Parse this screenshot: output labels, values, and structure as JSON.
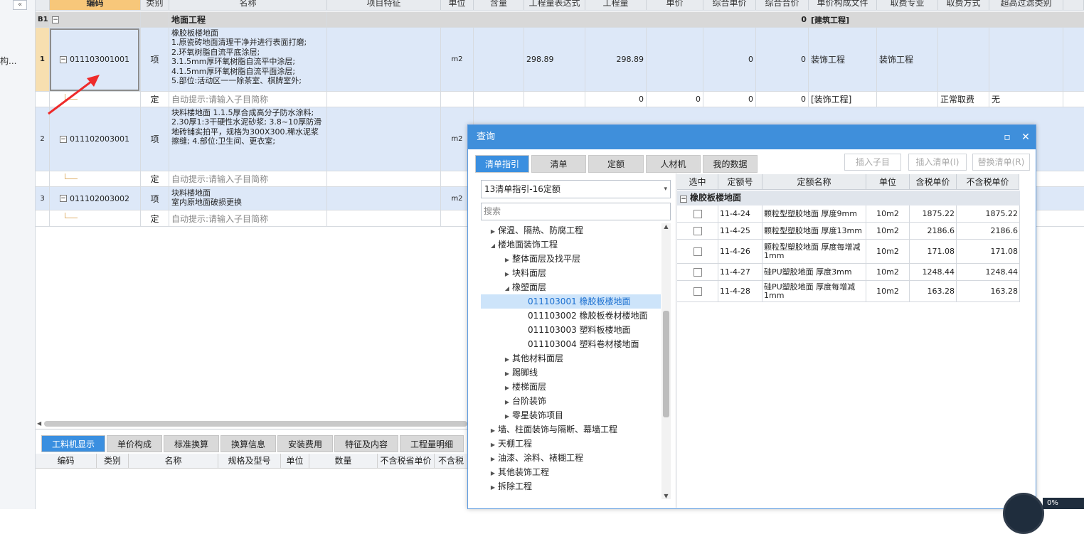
{
  "left": {
    "collapse_icon": "«",
    "label": "构..."
  },
  "grid": {
    "headers": [
      "编码",
      "类别",
      "名称",
      "项目特征",
      "单位",
      "含量",
      "工程量表达式",
      "工程量",
      "单价",
      "综合单价",
      "综合合价",
      "单价构成文件",
      "取费专业",
      "取费方式",
      "超高过滤类别"
    ],
    "section": {
      "id": "B1",
      "name": "地面工程",
      "total": "0",
      "file": "[建筑工程]"
    },
    "rows": [
      {
        "no": "1",
        "code": "011103001001",
        "type": "项",
        "name": "橡胶板楼地面\n1.原瓷砖地面清理干净并进行表面打磨;\n2.环氧树脂自流平底涂层;\n3.1.5mm厚环氧树脂自流平中涂层;\n4.1.5mm厚环氧树脂自流平面涂层;\n5.部位:活动区一一除茶室、棋牌室外;",
        "unit": "m2",
        "expr": "298.89",
        "qty": "298.89",
        "comp_price": "0",
        "comp_total": "0",
        "file": "装饰工程",
        "major": "装饰工程"
      },
      {
        "no": "",
        "code": "",
        "type": "定",
        "name": "自动提示:请输入子目简称",
        "qty": "0",
        "price": "0",
        "comp_price": "0",
        "comp_total": "0",
        "file": "[装饰工程]",
        "mode": "正常取费",
        "filter": "无"
      },
      {
        "no": "2",
        "code": "011102003001",
        "type": "项",
        "name": "块料楼地面\n1.1.5厚合成高分子防水涂料;\n2.30厚1:3干硬性水泥砂浆;\n3.8~10厚防滑地砖铺实拍平，规格为300X300.稀水泥浆擦缝;\n4.部位:卫生间、更衣室;",
        "unit": "m2"
      },
      {
        "no": "",
        "code": "",
        "type": "定",
        "name": "自动提示:请输入子目简称"
      },
      {
        "no": "3",
        "code": "011102003002",
        "type": "项",
        "name": "块料楼地面\n室内原地面破损更换",
        "unit": "m2"
      },
      {
        "no": "",
        "code": "",
        "type": "定",
        "name": "自动提示:请输入子目简称"
      }
    ]
  },
  "bottom": {
    "tabs": [
      "工料机显示",
      "单价构成",
      "标准换算",
      "换算信息",
      "安装费用",
      "特征及内容",
      "工程量明细"
    ],
    "active_tab": 0,
    "headers": [
      "编码",
      "类别",
      "名称",
      "规格及型号",
      "单位",
      "数量",
      "不含税省单价",
      "不含税威"
    ]
  },
  "dialog": {
    "title": "查询",
    "icons": {
      "max": "maximize-icon",
      "close": "close-icon"
    },
    "tabs": [
      "清单指引",
      "清单",
      "定额",
      "人材机",
      "我的数据"
    ],
    "active_tab": 0,
    "buttons": [
      "插入子目",
      "插入清单(I)",
      "替换清单(R)"
    ],
    "combo": "13清单指引-16定额",
    "search_placeholder": "搜索",
    "tree": [
      {
        "label": "保温、隔热、防腐工程",
        "level": 0,
        "state": "collapsed"
      },
      {
        "label": "楼地面装饰工程",
        "level": 0,
        "state": "expanded"
      },
      {
        "label": "整体面层及找平层",
        "level": 1,
        "state": "collapsed"
      },
      {
        "label": "块料面层",
        "level": 1,
        "state": "collapsed"
      },
      {
        "label": "橡塑面层",
        "level": 1,
        "state": "expanded"
      },
      {
        "label": "011103001  橡胶板楼地面",
        "level": 2,
        "state": "leaf",
        "selected": true
      },
      {
        "label": "011103002  橡胶板卷材楼地面",
        "level": 2,
        "state": "leaf"
      },
      {
        "label": "011103003  塑料板楼地面",
        "level": 2,
        "state": "leaf"
      },
      {
        "label": "011103004  塑料卷材楼地面",
        "level": 2,
        "state": "leaf"
      },
      {
        "label": "其他材料面层",
        "level": 1,
        "state": "collapsed"
      },
      {
        "label": "踢脚线",
        "level": 1,
        "state": "collapsed"
      },
      {
        "label": "楼梯面层",
        "level": 1,
        "state": "collapsed"
      },
      {
        "label": "台阶装饰",
        "level": 1,
        "state": "collapsed"
      },
      {
        "label": "零星装饰项目",
        "level": 1,
        "state": "collapsed"
      },
      {
        "label": "墙、柱面装饰与隔断、幕墙工程",
        "level": 0,
        "state": "collapsed"
      },
      {
        "label": "天棚工程",
        "level": 0,
        "state": "collapsed"
      },
      {
        "label": "油漆、涂料、裱糊工程",
        "level": 0,
        "state": "collapsed"
      },
      {
        "label": "其他装饰工程",
        "level": 0,
        "state": "collapsed"
      },
      {
        "label": "拆除工程",
        "level": 0,
        "state": "collapsed"
      }
    ],
    "quota_headers": [
      "选中",
      "定额号",
      "定额名称",
      "单位",
      "含税单价",
      "不含税单价"
    ],
    "quota_group": "橡胶板楼地面",
    "quotas": [
      {
        "code": "11-4-24",
        "name": "颗粒型塑胶地面 厚度9mm",
        "unit": "10m2",
        "tax_price": "1875.22",
        "notax_price": "1875.22"
      },
      {
        "code": "11-4-25",
        "name": "颗粒型塑胶地面 厚度13mm",
        "unit": "10m2",
        "tax_price": "2186.6",
        "notax_price": "2186.6"
      },
      {
        "code": "11-4-26",
        "name": "颗粒型塑胶地面 厚度每增减1mm",
        "unit": "10m2",
        "tax_price": "171.08",
        "notax_price": "171.08"
      },
      {
        "code": "11-4-27",
        "name": "硅PU塑胶地面 厚度3mm",
        "unit": "10m2",
        "tax_price": "1248.44",
        "notax_price": "1248.44"
      },
      {
        "code": "11-4-28",
        "name": "硅PU塑胶地面 厚度每增减1mm",
        "unit": "10m2",
        "tax_price": "163.28",
        "notax_price": "163.28"
      }
    ]
  },
  "overlay": {
    "text": "0%"
  }
}
